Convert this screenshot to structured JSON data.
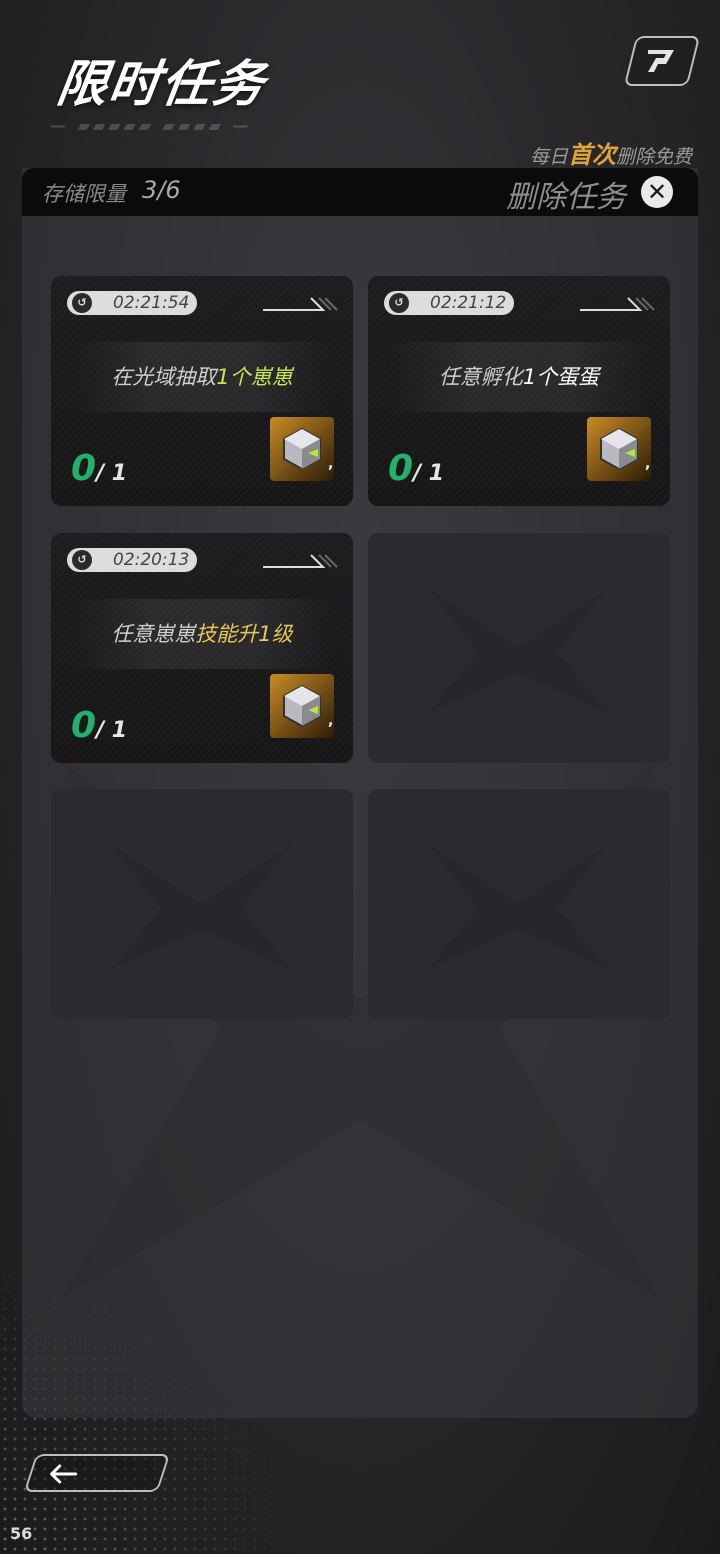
{
  "header": {
    "title": "限时任务",
    "daily_prefix": "每日",
    "daily_highlight": "首次",
    "daily_suffix": "删除免费"
  },
  "storage": {
    "label": "存储限量",
    "value": "3/6"
  },
  "delete_label": "删除任务",
  "tasks": [
    {
      "timer": "02:21:54",
      "mission_pre": "在光域抽取",
      "mission_hl": "1个崽崽",
      "mission_post": "",
      "hl_color": "green",
      "progress_current": "0",
      "progress_total": "/ 1",
      "reward_count": ","
    },
    {
      "timer": "02:21:12",
      "mission_pre": "任意孵化",
      "mission_hl": "1个蛋蛋",
      "mission_post": "",
      "hl_color": "white",
      "progress_current": "0",
      "progress_total": "/ 1",
      "reward_count": ","
    },
    {
      "timer": "02:20:13",
      "mission_pre": "任意崽崽",
      "mission_hl": "技能升1级",
      "mission_post": "",
      "hl_color": "yellow",
      "progress_current": "0",
      "progress_total": "/ 1",
      "reward_count": ","
    }
  ],
  "footer": {
    "fps": "56"
  },
  "colors": {
    "progress_green": "#23b06a",
    "highlight_orange": "#e0a33a",
    "mission_green": "#c4e85a",
    "mission_yellow": "#e8c65a"
  },
  "icons": [
    "brand-icon",
    "close-icon",
    "clock-icon",
    "reward-cube-icon",
    "back-arrow-icon"
  ]
}
